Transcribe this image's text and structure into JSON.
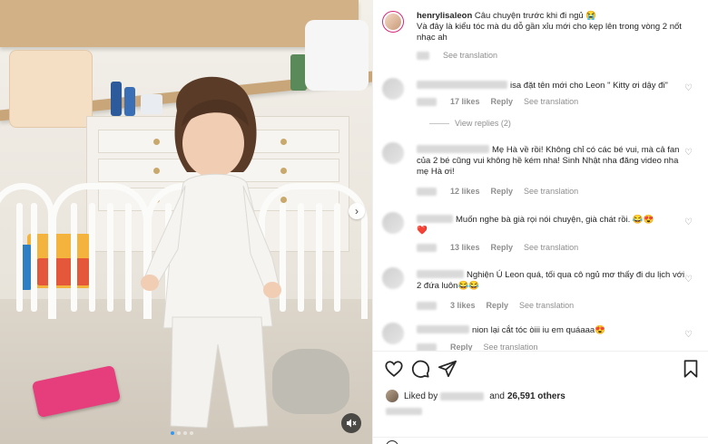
{
  "post": {
    "username": "henrylisaleon",
    "caption_line1": "Câu chuyện trước khi đi ngủ 😭",
    "caption_line2": "Và đây là kiểu tóc mà du dỗ gần xỉu mới cho kẹp lên trong vòng 2 nốt nhạc ah",
    "see_translation": "See translation"
  },
  "comments": [
    {
      "text": "isa đặt tên mới cho Leon \" Kitty ơi dậy đi\"",
      "likes": "17 likes",
      "reply": "Reply",
      "translate": "See translation",
      "view_replies": "View replies (2)"
    },
    {
      "text": "Mẹ Hà về rồi! Không chỉ có các bé vui, mà cả fan của 2 bé cũng vui không hề kém nha! Sinh Nhật nha đăng video nha mẹ Hà ơi!",
      "likes": "12 likes",
      "reply": "Reply",
      "translate": "See translation"
    },
    {
      "text": "Muốn nghe bà già rọi nói chuyện, già chát rồi. 😂😍",
      "text_extra": "❤️",
      "likes": "13 likes",
      "reply": "Reply",
      "translate": "See translation"
    },
    {
      "text": "Nghiện Ú Leon quá, tối qua cô ngủ mơ thấy đi du lịch với 2 đứa luôn😂😂",
      "likes": "3 likes",
      "reply": "Reply",
      "translate": "See translation"
    },
    {
      "text": "nion lại cắt tóc òiii iu em quáaaa😍",
      "likes": "",
      "reply": "Reply",
      "translate": "See translation"
    }
  ],
  "actions": {
    "liked_by_prefix": "Liked by",
    "liked_by_and": "and",
    "liked_by_count": "26,591 others"
  },
  "icons": {
    "like": "heart-icon",
    "comment": "comment-icon",
    "share": "share-icon",
    "save": "bookmark-icon",
    "next": "chevron-right-icon",
    "mute": "mute-icon",
    "comment_like": "heart-outline-icon"
  },
  "colors": {
    "accent": "#3897f0",
    "muted_text": "#8e8e8e",
    "text": "#262626"
  }
}
